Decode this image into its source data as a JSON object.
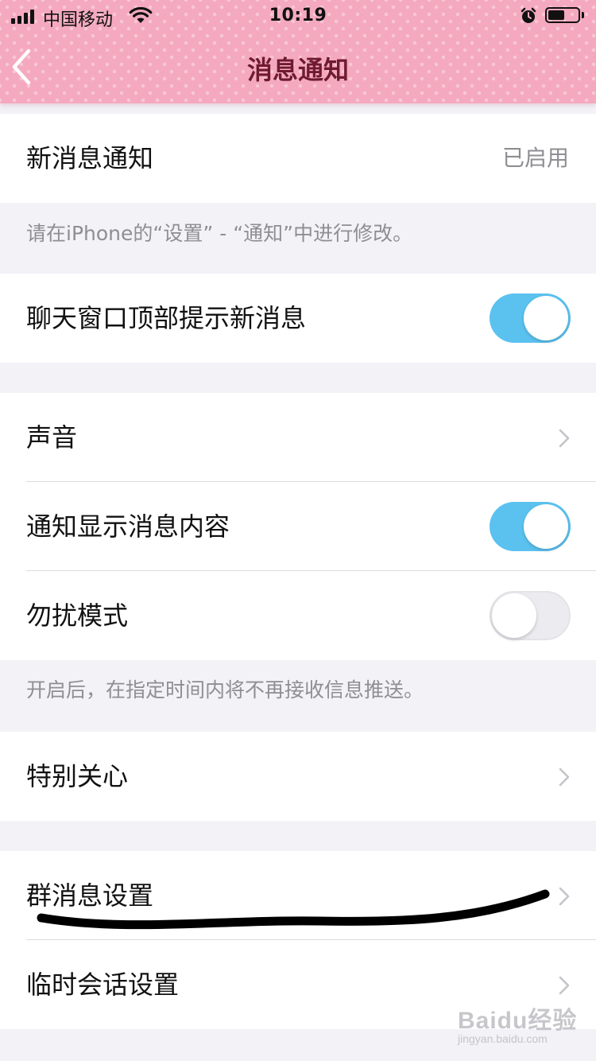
{
  "status_bar": {
    "carrier": "中国移动",
    "time": "10:19",
    "battery_level": 0.55,
    "icons": [
      "signal-icon",
      "wifi-icon",
      "alarm-icon",
      "battery-icon"
    ]
  },
  "nav": {
    "title": "消息通知",
    "back_icon": "chevron-left-icon"
  },
  "sections": {
    "new_message": {
      "label": "新消息通知",
      "value": "已启用",
      "footer": "请在iPhone的“设置” - “通知”中进行修改。"
    },
    "chat_top": {
      "label": "聊天窗口顶部提示新消息",
      "enabled": true
    },
    "sound": {
      "label": "声音"
    },
    "show_content": {
      "label": "通知显示消息内容",
      "enabled": true
    },
    "dnd": {
      "label": "勿扰模式",
      "enabled": false,
      "footer": "开启后，在指定时间内将不再接收信息推送。"
    },
    "special_care": {
      "label": "特别关心"
    },
    "group_settings": {
      "label": "群消息设置"
    },
    "temp_chat": {
      "label": "临时会话设置"
    }
  },
  "colors": {
    "header_pink": "#f4a9bf",
    "title_color": "#6f1a2f",
    "toggle_on": "#5bc2f0",
    "toggle_off": "#ebebf0",
    "background": "#f2f2f7"
  },
  "watermark": {
    "main": "Baidu经验",
    "sub": "jingyan.baidu.com"
  }
}
